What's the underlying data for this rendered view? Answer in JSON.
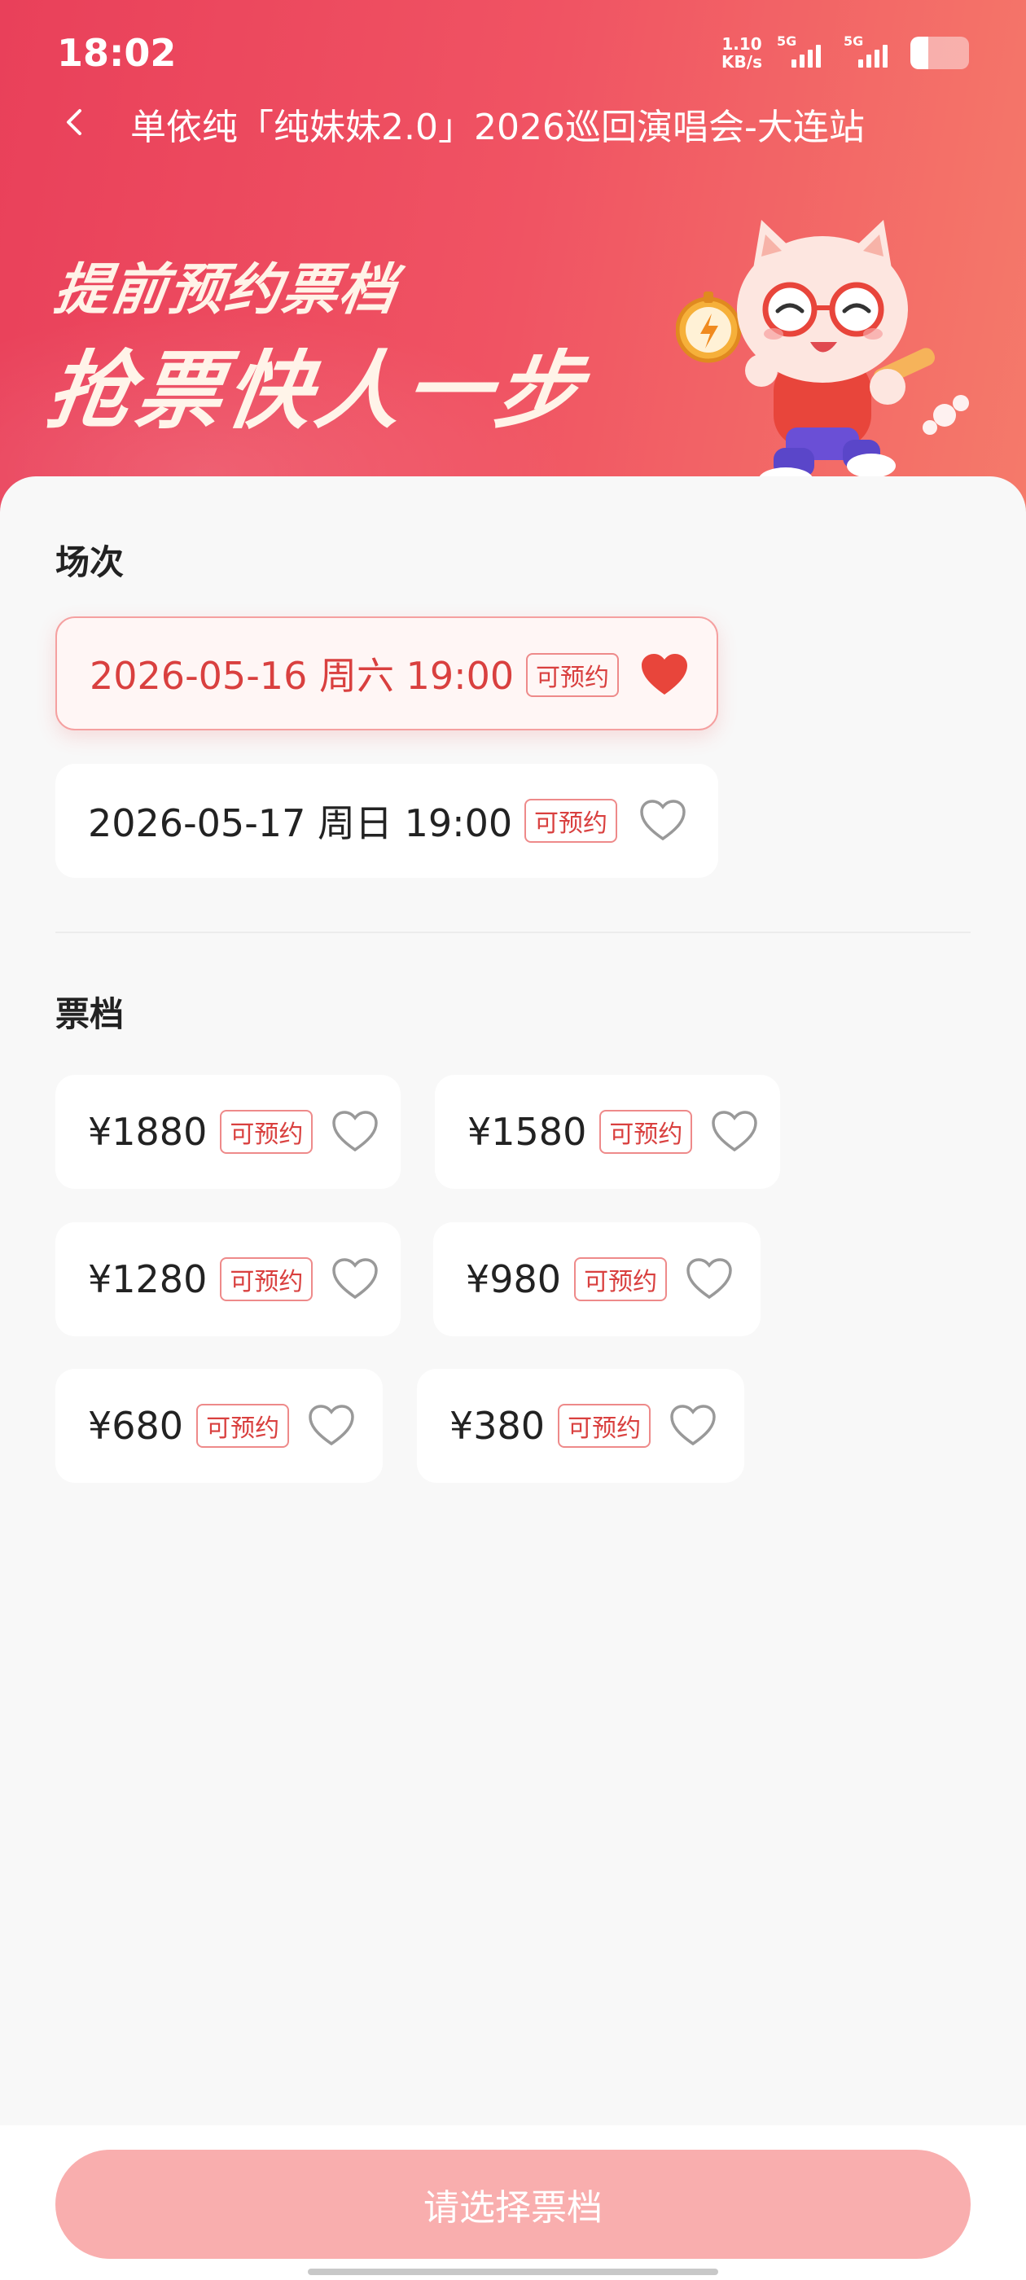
{
  "status_bar": {
    "time": "18:02",
    "net_speed_value": "1.10",
    "net_speed_unit": "KB/s",
    "sim1_label": "5G",
    "sim2_label": "5G",
    "battery_level": 0.3
  },
  "nav": {
    "title": "单依纯「纯妹妹2.0」2026巡回演唱会-大连站"
  },
  "banner": {
    "line1": "提前预约票档",
    "line2": "抢票快人一步"
  },
  "sessions": {
    "title": "场次",
    "items": [
      {
        "label": "2026-05-16 周六 19:00",
        "badge": "可预约",
        "selected": true
      },
      {
        "label": "2026-05-17 周日 19:00",
        "badge": "可预约",
        "selected": false
      }
    ]
  },
  "tiers": {
    "title": "票档",
    "items": [
      {
        "price": "¥1880",
        "badge": "可预约"
      },
      {
        "price": "¥1580",
        "badge": "可预约"
      },
      {
        "price": "¥1280",
        "badge": "可预约"
      },
      {
        "price": "¥980",
        "badge": "可预约"
      },
      {
        "price": "¥680",
        "badge": "可预约"
      },
      {
        "price": "¥380",
        "badge": "可预约"
      }
    ]
  },
  "footer": {
    "submit_label": "请选择票档"
  },
  "colors": {
    "accent": "#d9403f",
    "button_disabled": "#f9aeae",
    "header_start": "#e9405a",
    "header_end": "#f57a6a"
  }
}
